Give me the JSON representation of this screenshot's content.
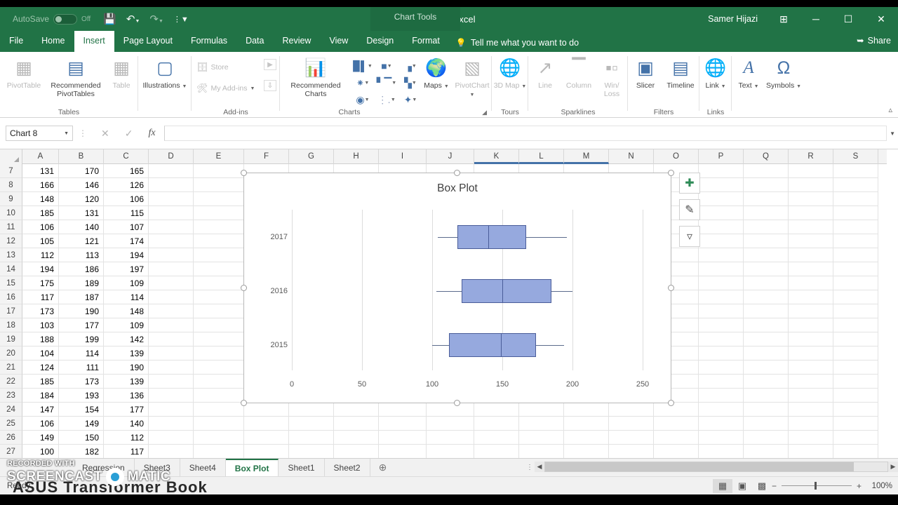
{
  "titlebar": {
    "autosave_label": "AutoSave",
    "autosave_state": "Off",
    "save_icon": "save-icon",
    "undo_icon": "undo-icon",
    "redo_icon": "redo-icon",
    "customize_icon": "customize-qat-icon",
    "document_title": "Excel  -  Excel",
    "context_tools": "Chart Tools",
    "user_name": "Samer Hijazi",
    "ribbon_display_icon": "ribbon-display-options-icon",
    "minimize": "─",
    "maximize": "☐",
    "close": "✕"
  },
  "ribbon_tabs": [
    {
      "label": "File",
      "active": false
    },
    {
      "label": "Home",
      "active": false
    },
    {
      "label": "Insert",
      "active": true
    },
    {
      "label": "Page Layout",
      "active": false
    },
    {
      "label": "Formulas",
      "active": false
    },
    {
      "label": "Data",
      "active": false
    },
    {
      "label": "Review",
      "active": false
    },
    {
      "label": "View",
      "active": false
    },
    {
      "label": "Design",
      "active": false
    },
    {
      "label": "Format",
      "active": false
    }
  ],
  "tellme": {
    "label": "Tell me what you want to do",
    "icon": "lightbulb-icon"
  },
  "share": {
    "label": "Share",
    "icon": "share-icon"
  },
  "ribbon_groups": [
    {
      "name": "Tables",
      "buttons": [
        {
          "label": "PivotTable",
          "icon": "pivottable-icon",
          "disabled": true
        },
        {
          "label": "Recommended PivotTables",
          "icon": "recommended-pivottables-icon",
          "disabled": false
        },
        {
          "label": "Table",
          "icon": "table-icon",
          "disabled": true
        }
      ]
    },
    {
      "name": "Illustrations",
      "buttons": [
        {
          "label": "Illustrations",
          "icon": "illustrations-icon",
          "disabled": false
        }
      ]
    },
    {
      "name": "Add-ins",
      "buttons": [
        {
          "label": "Store",
          "icon": "store-icon",
          "disabled": true
        },
        {
          "label": "My Add-ins",
          "icon": "my-addins-icon",
          "disabled": true
        }
      ]
    },
    {
      "name": "Charts",
      "buttons": [
        {
          "label": "Recommended Charts",
          "icon": "recommended-charts-icon",
          "disabled": false
        }
      ],
      "chart_type_icons": [
        "column-chart-icon",
        "bar-chart-icon",
        "waterfall-chart-icon",
        "stock-chart-icon",
        "histogram-chart-icon",
        "combo-chart-icon",
        "pie-chart-icon",
        "scatter-chart-icon",
        "radar-chart-icon"
      ],
      "dialog_launcher": "charts-dialog-launcher"
    },
    {
      "name": "Tours",
      "buttons": [
        {
          "label": "Maps",
          "icon": "maps-icon",
          "disabled": false
        },
        {
          "label": "PivotChart",
          "icon": "pivotchart-icon",
          "disabled": true
        },
        {
          "label": "3D Map",
          "icon": "3d-map-icon",
          "disabled": true
        }
      ]
    },
    {
      "name": "Sparklines",
      "buttons": [
        {
          "label": "Line",
          "icon": "sparkline-line-icon",
          "disabled": true
        },
        {
          "label": "Column",
          "icon": "sparkline-column-icon",
          "disabled": true
        },
        {
          "label": "Win/ Loss",
          "icon": "sparkline-winloss-icon",
          "disabled": true
        }
      ]
    },
    {
      "name": "Filters",
      "buttons": [
        {
          "label": "Slicer",
          "icon": "slicer-icon",
          "disabled": false
        },
        {
          "label": "Timeline",
          "icon": "timeline-icon",
          "disabled": false
        }
      ]
    },
    {
      "name": "Links",
      "buttons": [
        {
          "label": "Link",
          "icon": "link-icon",
          "disabled": false
        }
      ]
    },
    {
      "name": "",
      "buttons": [
        {
          "label": "Text",
          "icon": "text-icon",
          "disabled": false
        },
        {
          "label": "Symbols",
          "icon": "symbols-icon",
          "disabled": false
        }
      ]
    }
  ],
  "group_labels": {
    "tables": "Tables",
    "addins": "Add-ins",
    "charts": "Charts",
    "tours": "Tours",
    "sparklines": "Sparklines",
    "filters": "Filters",
    "links": "Links"
  },
  "ribbon_button_labels": {
    "pivottable": "PivotTable",
    "recommended_pivottables": "Recommended PivotTables",
    "table": "Table",
    "illustrations": "Illustrations",
    "store": "Store",
    "my_addins": "My Add-ins",
    "recommended_charts": "Recommended Charts",
    "maps": "Maps",
    "pivotchart": "PivotChart",
    "map3d": "3D Map",
    "line": "Line",
    "column": "Column",
    "winloss": "Win/ Loss",
    "slicer": "Slicer",
    "timeline": "Timeline",
    "link": "Link",
    "text": "Text",
    "symbols": "Symbols"
  },
  "formula_bar": {
    "name_box_value": "Chart 8",
    "cancel_icon": "cancel-icon",
    "enter_icon": "enter-icon",
    "function_icon": "insert-function-icon",
    "formula_value": ""
  },
  "grid": {
    "columns": [
      "A",
      "B",
      "C",
      "D",
      "E",
      "F",
      "G",
      "H",
      "I",
      "J",
      "K",
      "L",
      "M",
      "N",
      "O",
      "P",
      "Q",
      "R",
      "S"
    ],
    "selected_columns": [
      "K",
      "L",
      "M"
    ],
    "rows": [
      {
        "num": "7",
        "cells": [
          "131",
          "170",
          "165"
        ]
      },
      {
        "num": "8",
        "cells": [
          "166",
          "146",
          "126"
        ]
      },
      {
        "num": "9",
        "cells": [
          "148",
          "120",
          "106"
        ]
      },
      {
        "num": "10",
        "cells": [
          "185",
          "131",
          "115"
        ]
      },
      {
        "num": "11",
        "cells": [
          "106",
          "140",
          "107"
        ]
      },
      {
        "num": "12",
        "cells": [
          "105",
          "121",
          "174"
        ]
      },
      {
        "num": "13",
        "cells": [
          "112",
          "113",
          "194"
        ]
      },
      {
        "num": "14",
        "cells": [
          "194",
          "186",
          "197"
        ]
      },
      {
        "num": "15",
        "cells": [
          "175",
          "189",
          "109"
        ]
      },
      {
        "num": "16",
        "cells": [
          "117",
          "187",
          "114"
        ]
      },
      {
        "num": "17",
        "cells": [
          "173",
          "190",
          "148"
        ]
      },
      {
        "num": "18",
        "cells": [
          "103",
          "177",
          "109"
        ]
      },
      {
        "num": "19",
        "cells": [
          "188",
          "199",
          "142"
        ]
      },
      {
        "num": "20",
        "cells": [
          "104",
          "114",
          "139"
        ]
      },
      {
        "num": "21",
        "cells": [
          "124",
          "111",
          "190"
        ]
      },
      {
        "num": "22",
        "cells": [
          "185",
          "173",
          "139"
        ]
      },
      {
        "num": "23",
        "cells": [
          "184",
          "193",
          "136"
        ]
      },
      {
        "num": "24",
        "cells": [
          "147",
          "154",
          "177"
        ]
      },
      {
        "num": "25",
        "cells": [
          "106",
          "149",
          "140"
        ]
      },
      {
        "num": "26",
        "cells": [
          "149",
          "150",
          "112"
        ]
      },
      {
        "num": "27",
        "cells": [
          "100",
          "182",
          "117"
        ]
      }
    ]
  },
  "chart_data": {
    "type": "box",
    "title": "Box Plot",
    "xlabel": "",
    "ylabel": "",
    "xlim": [
      0,
      260
    ],
    "xticks": [
      0,
      50,
      100,
      150,
      200,
      250
    ],
    "categories": [
      "2015",
      "2016",
      "2017"
    ],
    "grid": true,
    "legend": "none",
    "box_fill_color": "#96a9de",
    "box_border_color": "#4a5d99",
    "series": [
      {
        "name": "2017",
        "min": 104,
        "q1": 118,
        "median": 140,
        "q3": 167,
        "max": 196
      },
      {
        "name": "2016",
        "min": 103,
        "q1": 121,
        "median": 150,
        "q3": 185,
        "max": 200
      },
      {
        "name": "2015",
        "min": 100,
        "q1": 112,
        "median": 149,
        "q3": 174,
        "max": 194
      }
    ]
  },
  "chart_side_buttons": [
    {
      "icon": "chart-elements-plus-icon",
      "glyph": "✚",
      "color": "#2e8b57"
    },
    {
      "icon": "chart-styles-brush-icon",
      "glyph": "✎",
      "color": "#4a4a4a"
    },
    {
      "icon": "chart-filters-funnel-icon",
      "glyph": "▽",
      "color": "#555555"
    }
  ],
  "sheet_tabs": [
    {
      "label": "Regression",
      "active": false
    },
    {
      "label": "Sheet3",
      "active": false
    },
    {
      "label": "Sheet4",
      "active": false
    },
    {
      "label": "Box Plot",
      "active": true
    },
    {
      "label": "Sheet1",
      "active": false
    },
    {
      "label": "Sheet2",
      "active": false
    }
  ],
  "add_sheet": {
    "glyph": "⊕",
    "label": "New sheet"
  },
  "status_bar": {
    "status_text": "Ready",
    "view_normal_icon": "normal-view-icon",
    "view_pagelayout_icon": "page-layout-view-icon",
    "view_pagebreak_icon": "page-break-preview-icon",
    "zoom_out": "−",
    "zoom_in": "+",
    "zoom_level": "100%"
  },
  "watermark": {
    "line1": "RECORDED WITH",
    "line2a": "SCREENCAST",
    "line2b": "MATIC"
  }
}
